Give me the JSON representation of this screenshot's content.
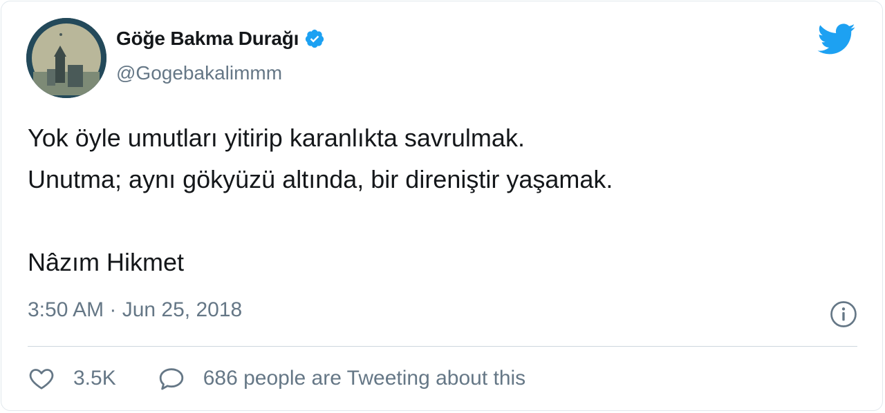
{
  "author": {
    "name": "Göğe Bakma Durağı",
    "handle": "@Gogebakalimmm",
    "verified": true,
    "avatar_icon": "profile-photo"
  },
  "tweet": {
    "lines": [
      "Yok öyle umutları yitirip karanlıkta savrulmak.",
      "Unutma; aynı gökyüzü altında, bir direniştir yaşamak."
    ],
    "signature": "Nâzım Hikmet"
  },
  "meta": {
    "timestamp": "3:50 AM · Jun 25, 2018",
    "info_icon": "info-icon"
  },
  "actions": {
    "like_count": "3.5K",
    "like_icon": "heart-icon",
    "reply_icon": "comment-icon",
    "reply_label": "686 people are Tweeting about this"
  },
  "colors": {
    "twitter_blue": "#1da1f2",
    "secondary_text": "#657786",
    "primary_text": "#14171a",
    "border": "#e1e8ed"
  }
}
